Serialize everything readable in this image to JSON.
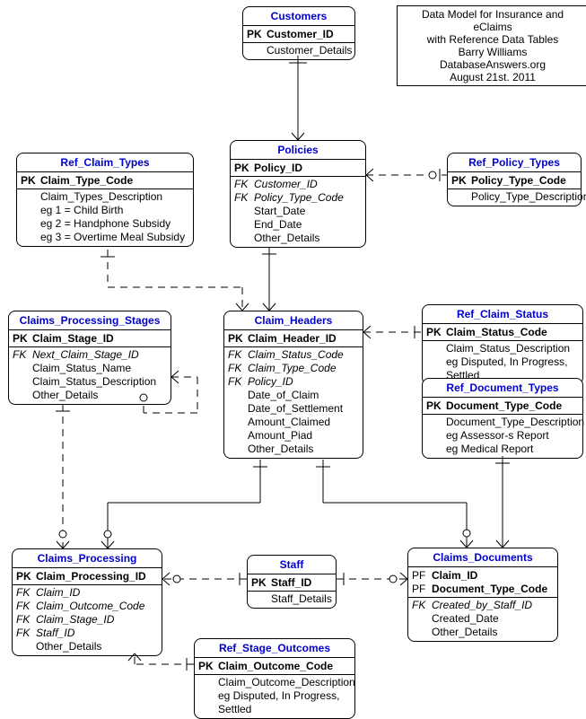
{
  "info_box": {
    "line1": "Data Model for Insurance and eClaims",
    "line2": "with Reference Data Tables",
    "line3": "Barry Williams",
    "line4": "DatabaseAnswers.org",
    "line5": "August 21st. 2011"
  },
  "entities": {
    "customers": {
      "title": "Customers",
      "pk": "Customer_ID",
      "attrs": [
        "Customer_Details"
      ]
    },
    "ref_claim_types": {
      "title": "Ref_Claim_Types",
      "pk": "Claim_Type_Code",
      "attrs": [
        "Claim_Types_Description",
        "eg 1 = Child Birth",
        "eg 2 = Handphone Subsidy",
        "eg 3 = Overtime Meal Subsidy"
      ]
    },
    "policies": {
      "title": "Policies",
      "pk": "Policy_ID",
      "fks": [
        "Customer_ID",
        "Policy_Type_Code"
      ],
      "attrs": [
        "Start_Date",
        "End_Date",
        "Other_Details"
      ]
    },
    "ref_policy_types": {
      "title": "Ref_Policy_Types",
      "pk": "Policy_Type_Code",
      "attrs": [
        "Policy_Type_Description"
      ]
    },
    "claims_processing_stages": {
      "title": "Claims_Processing_Stages",
      "pk": "Claim_Stage_ID",
      "fks": [
        "Next_Claim_Stage_ID"
      ],
      "attrs": [
        "Claim_Status_Name",
        "Claim_Status_Description",
        "Other_Details"
      ]
    },
    "claim_headers": {
      "title": "Claim_Headers",
      "pk": "Claim_Header_ID",
      "fks": [
        "Claim_Status_Code",
        "Claim_Type_Code",
        "Policy_ID"
      ],
      "attrs": [
        "Date_of_Claim",
        "Date_of_Settlement",
        "Amount_Claimed",
        "Amount_Piad",
        "Other_Details"
      ]
    },
    "ref_claim_status": {
      "title": "Ref_Claim_Status",
      "pk": "Claim_Status_Code",
      "attrs": [
        "Claim_Status_Description",
        "eg Disputed, In Progress, Settled"
      ]
    },
    "ref_document_types": {
      "title": "Ref_Document_Types",
      "pk": "Document_Type_Code",
      "attrs": [
        "Document_Type_Description",
        "eg Assessor-s Report",
        "eg Medical Report"
      ]
    },
    "claims_processing": {
      "title": "Claims_Processing",
      "pk": "Claim_Processing_ID",
      "fks": [
        "Claim_ID",
        "Claim_Outcome_Code",
        "Claim_Stage_ID",
        "Staff_ID"
      ],
      "attrs": [
        "Other_Details"
      ]
    },
    "staff": {
      "title": "Staff",
      "pk": "Staff_ID",
      "attrs": [
        "Staff_Details"
      ]
    },
    "claims_documents": {
      "title": "Claims_Documents",
      "pfs": [
        "Claim_ID",
        "Document_Type_Code"
      ],
      "fks": [
        "Created_by_Staff_ID"
      ],
      "attrs": [
        "Created_Date",
        "Other_Details"
      ]
    },
    "ref_stage_outcomes": {
      "title": "Ref_Stage_Outcomes",
      "pk": "Claim_Outcome_Code",
      "attrs": [
        "Claim_Outcome_Description",
        "eg Disputed, In Progress, Settled"
      ]
    }
  }
}
